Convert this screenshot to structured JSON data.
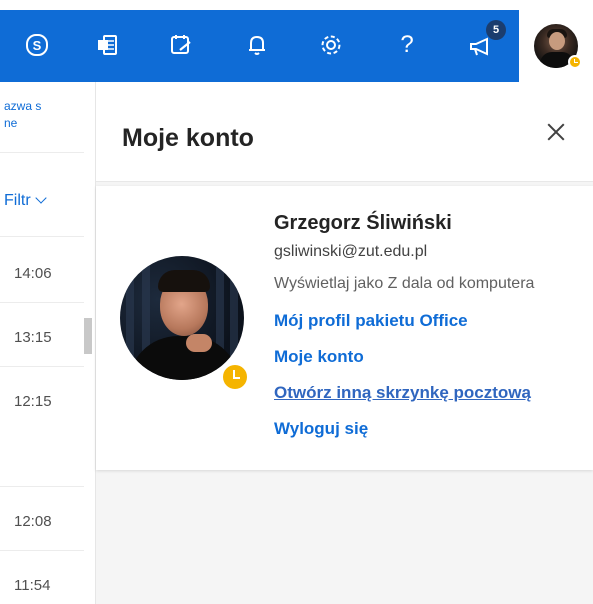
{
  "topbar": {
    "background_color": "#0f6cd6",
    "icons": [
      "skype-icon",
      "office-icon",
      "todo-icon",
      "bell-icon",
      "gear-icon",
      "help-icon",
      "megaphone-icon"
    ],
    "help_glyph": "?",
    "notification_badge": "5"
  },
  "message_list": {
    "header_text_1": "azwa s",
    "header_text_2": "ne",
    "filter_label": "Filtr",
    "times": [
      "14:06",
      "13:15",
      "12:15",
      "12:08",
      "11:54"
    ]
  },
  "panel": {
    "title": "Moje konto",
    "user": {
      "name": "Grzegorz Śliwiński",
      "email": "gsliwinski@zut.edu.pl",
      "status": "Wyświetlaj jako Z dala od komputera",
      "presence_color": "#f5b400"
    },
    "links": {
      "office_profile": "Mój profil pakietu Office",
      "my_account": "Moje konto",
      "open_mailbox": "Otwórz inną skrzynkę pocztową",
      "sign_out": "Wyloguj się"
    }
  }
}
